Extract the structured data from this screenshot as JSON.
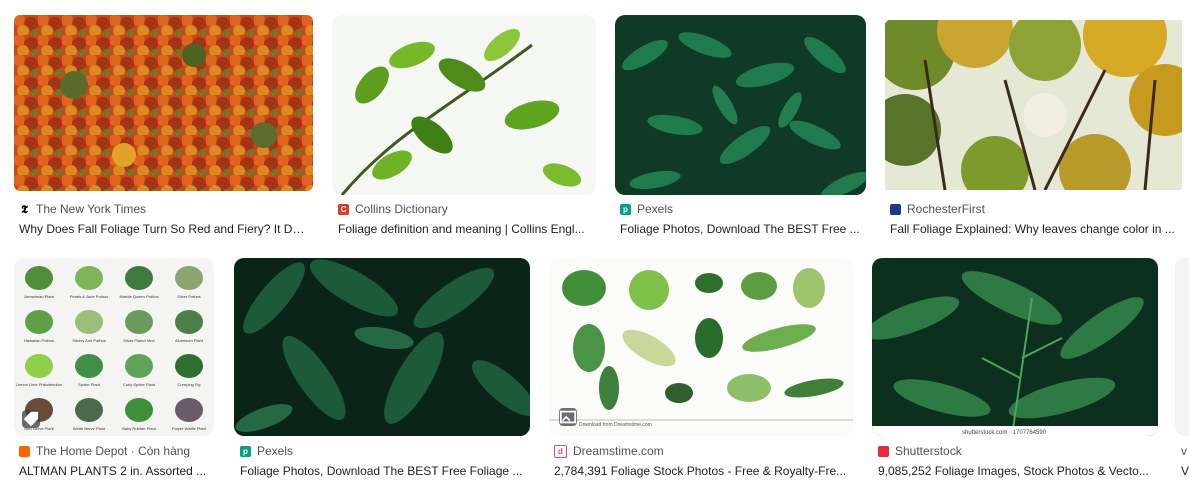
{
  "results": [
    {
      "source": "The New York Times",
      "title": "Why Does Fall Foliage Turn So Red and Fiery? It De...",
      "favicon": "nyt-favicon"
    },
    {
      "source": "Collins Dictionary",
      "title": "Foliage definition and meaning | Collins Engl...",
      "favicon": "collins-favicon"
    },
    {
      "source": "Pexels",
      "title": "Foliage Photos, Download The BEST Free ...",
      "favicon": "pexels-favicon"
    },
    {
      "source": "RochesterFirst",
      "title": "Fall Foliage Explained: Why leaves change color in ...",
      "favicon": "rochesterfirst-favicon"
    },
    {
      "source": "The Home Depot · Còn hàng",
      "title": "ALTMAN PLANTS 2 in. Assorted ...",
      "favicon": "homedepot-favicon"
    },
    {
      "source": "Pexels",
      "title": "Foliage Photos, Download The BEST Free Foliage ...",
      "favicon": "pexels-favicon"
    },
    {
      "source": "Dreamstime.com",
      "title": "2,784,391 Foliage Stock Photos - Free & Royalty-Fre...",
      "favicon": "dreamstime-favicon"
    },
    {
      "source": "Shutterstock",
      "title": "9,085,252 Foliage Images, Stock Photos & Vecto...",
      "favicon": "shutterstock-favicon"
    },
    {
      "source": "v",
      "title": "V",
      "favicon": ""
    }
  ],
  "image_text": {
    "plant_chart_labels": [
      "Arrowhead Plant",
      "Pearls & Jade Pothos",
      "Marble Queen Pothos",
      "Silver Pothos",
      "Hawaiian Pothos",
      "Silvery Ann Pothos",
      "Silver Plated Vine",
      "Aluminum Plant",
      "Lemon Lime Philodendron",
      "Spider Plant",
      "Curly Spider Plant",
      "Creeping Fig",
      "Red Nerve Plant",
      "White Nerve Plant",
      "Baby Rubber Plant",
      "Purple Waffle Plant"
    ],
    "dreamstime_watermark": "Download from Dreamstime.com",
    "shutterstock_watermark": "shutterstock.com · 1707764590"
  },
  "colors": {
    "source_text": "#4d5156",
    "title_text": "#202124"
  }
}
